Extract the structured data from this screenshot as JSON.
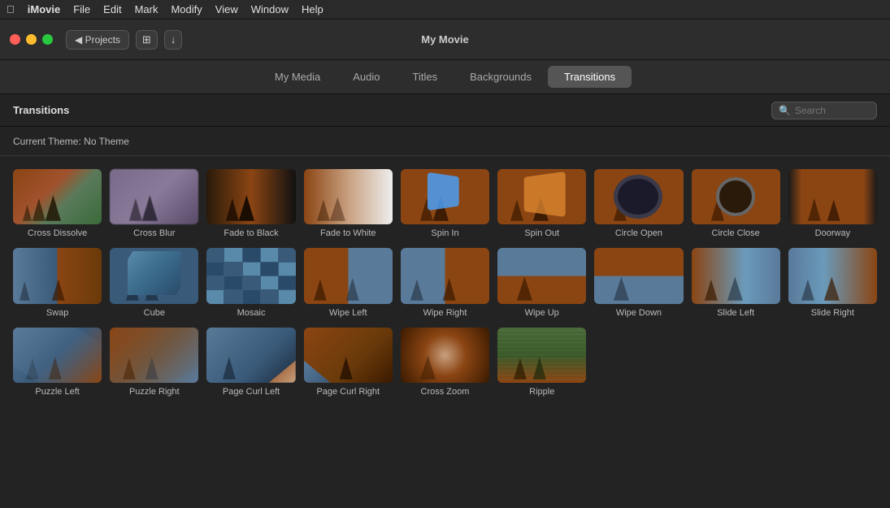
{
  "menubar": {
    "apple": "⌘",
    "app": "iMovie",
    "items": [
      "File",
      "Edit",
      "Mark",
      "Modify",
      "View",
      "Window",
      "Help"
    ]
  },
  "titlebar": {
    "title": "My Movie",
    "projects_label": "◀ Projects",
    "btn_grid": "⊞",
    "btn_down": "↓"
  },
  "tabs": [
    {
      "id": "my-media",
      "label": "My Media"
    },
    {
      "id": "audio",
      "label": "Audio"
    },
    {
      "id": "titles",
      "label": "Titles"
    },
    {
      "id": "backgrounds",
      "label": "Backgrounds"
    },
    {
      "id": "transitions",
      "label": "Transitions",
      "active": true
    }
  ],
  "content": {
    "title": "Transitions",
    "theme_label": "Current Theme: No Theme",
    "search_placeholder": "Search"
  },
  "transitions": [
    {
      "id": "cross-dissolve",
      "label": "Cross Dissolve"
    },
    {
      "id": "cross-blur",
      "label": "Cross Blur"
    },
    {
      "id": "fade-to-black",
      "label": "Fade to Black"
    },
    {
      "id": "fade-to-white",
      "label": "Fade to White"
    },
    {
      "id": "spin-in",
      "label": "Spin In"
    },
    {
      "id": "spin-out",
      "label": "Spin Out"
    },
    {
      "id": "circle-open",
      "label": "Circle Open"
    },
    {
      "id": "circle-close",
      "label": "Circle Close"
    },
    {
      "id": "doorway",
      "label": "Doorway"
    },
    {
      "id": "swap",
      "label": "Swap"
    },
    {
      "id": "cube",
      "label": "Cube"
    },
    {
      "id": "mosaic",
      "label": "Mosaic"
    },
    {
      "id": "wipe-left",
      "label": "Wipe Left"
    },
    {
      "id": "wipe-right",
      "label": "Wipe Right"
    },
    {
      "id": "wipe-up",
      "label": "Wipe Up"
    },
    {
      "id": "wipe-down",
      "label": "Wipe Down"
    },
    {
      "id": "slide-left",
      "label": "Slide Left"
    },
    {
      "id": "slide-right",
      "label": "Slide Right"
    },
    {
      "id": "puzzle-left",
      "label": "Puzzle Left"
    },
    {
      "id": "puzzle-right",
      "label": "Puzzle Right"
    },
    {
      "id": "page-curl-left",
      "label": "Page Curl Left"
    },
    {
      "id": "page-curl-right",
      "label": "Page Curl Right"
    },
    {
      "id": "cross-zoom",
      "label": "Cross Zoom"
    },
    {
      "id": "ripple",
      "label": "Ripple"
    }
  ]
}
